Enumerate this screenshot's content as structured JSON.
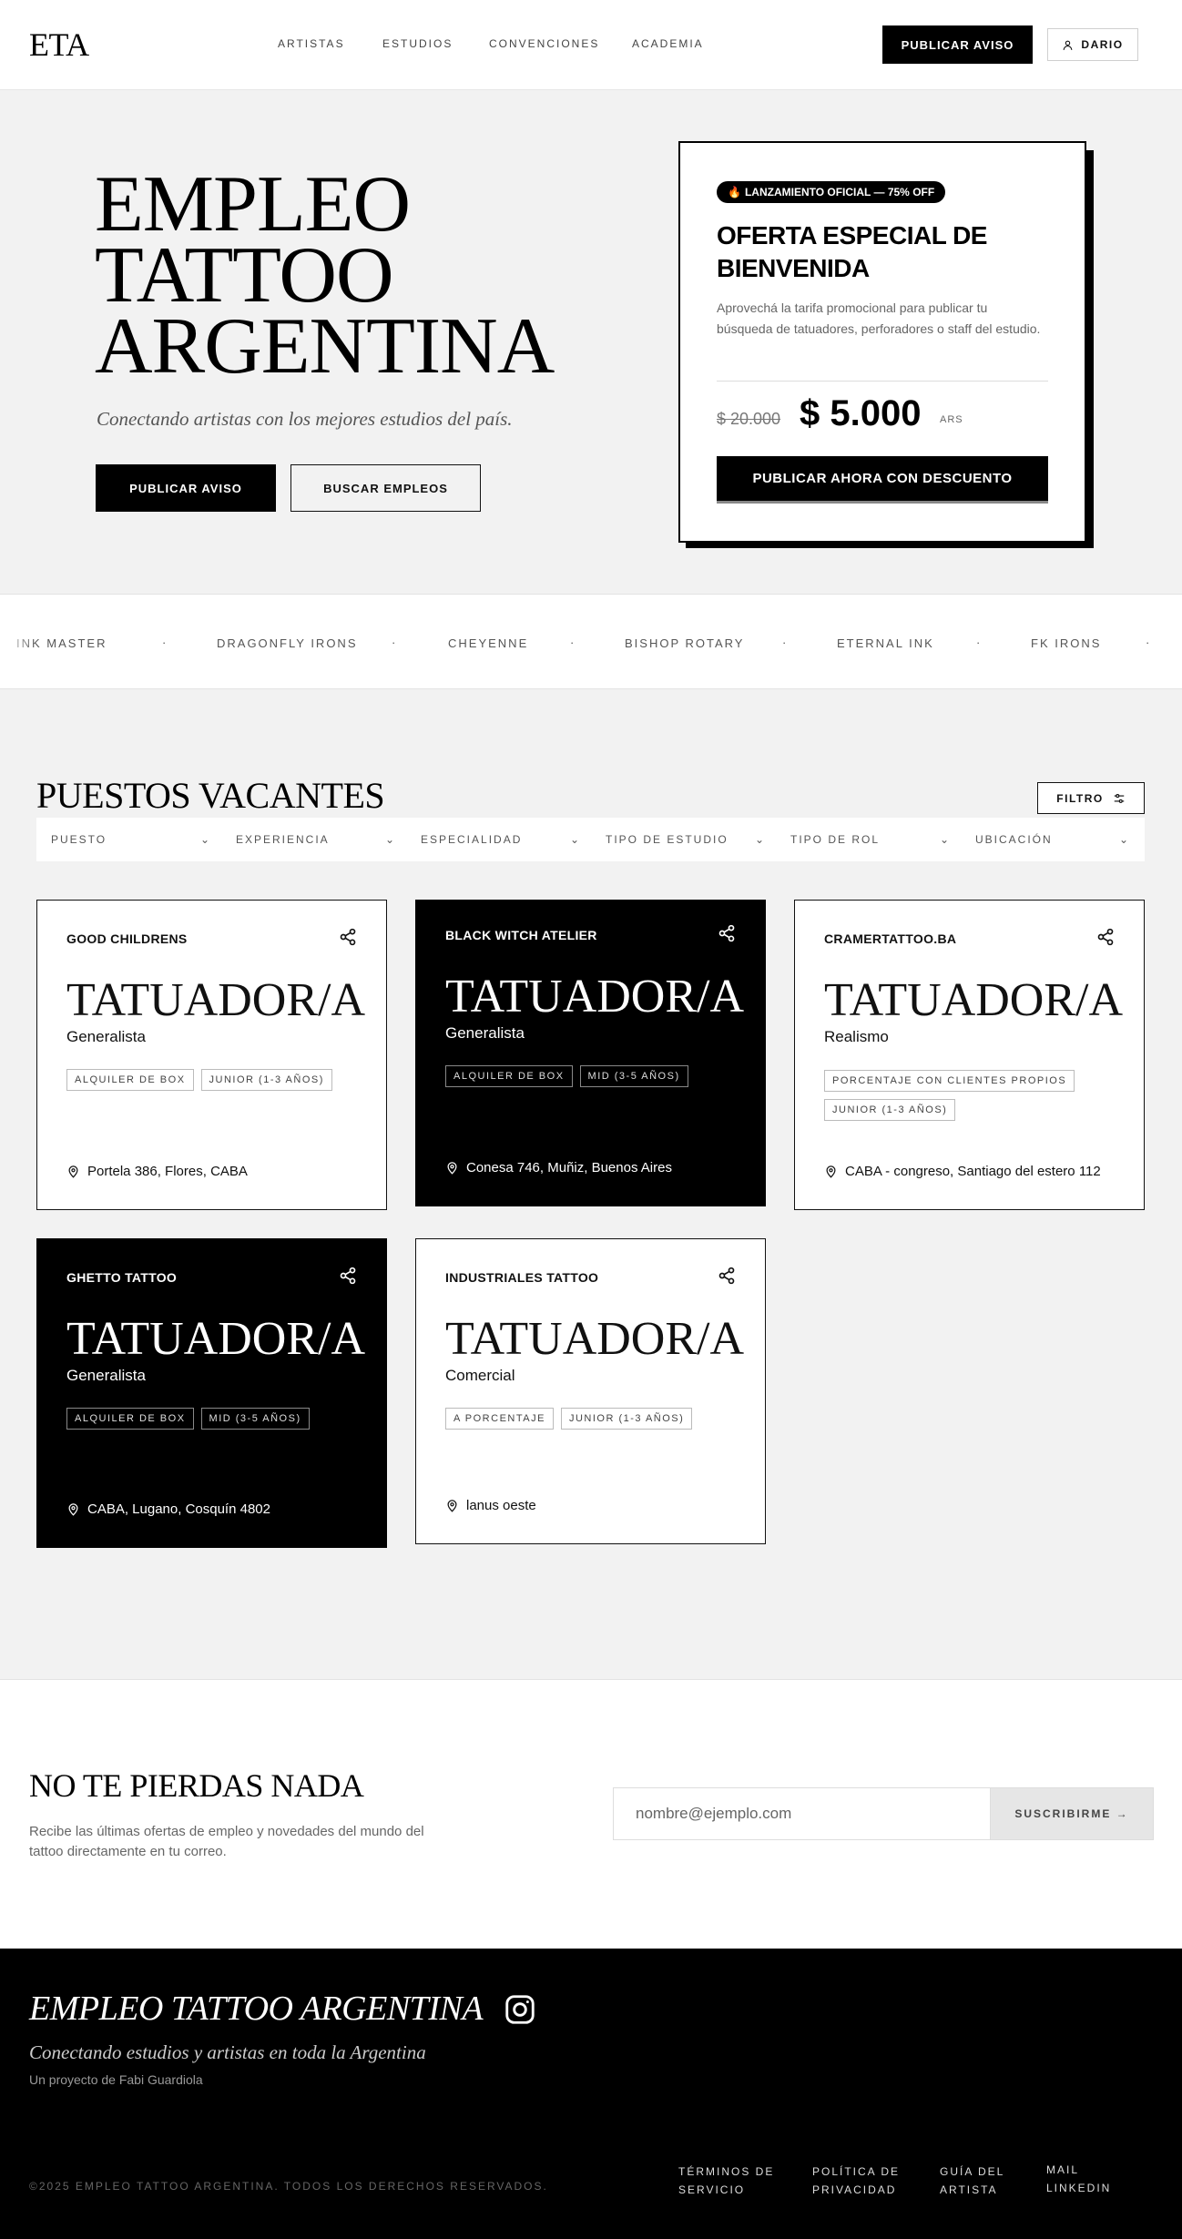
{
  "nav": {
    "logo": "ETA",
    "links": [
      "ARTISTAS",
      "ESTUDIOS",
      "CONVENCIONES",
      "ACADEMIA"
    ],
    "publish_label": "PUBLICAR AVISO",
    "user_label": "DARIO"
  },
  "hero": {
    "title_line1": "EMPLEO",
    "title_line2": "TATTOO",
    "title_line3": "ARGENTINA",
    "subtitle": "Conectando artistas con los mejores estudios del país.",
    "primary_label": "PUBLICAR AVISO",
    "secondary_label": "BUSCAR EMPLEOS"
  },
  "promo": {
    "badge": "LANZAMIENTO OFICIAL — 75% OFF",
    "title": "OFERTA ESPECIAL DE BIENVENIDA",
    "description": "Aprovechá la tarifa promocional para publicar tu búsqueda de tatuadores, perforadores o staff del estudio.",
    "old_price": "$ 20.000",
    "new_price": "$ 5.000",
    "currency": "ARS",
    "cta": "PUBLICAR AHORA CON DESCUENTO"
  },
  "brands": [
    "INK MASTER",
    "DRAGONFLY IRONS",
    "CHEYENNE",
    "BISHOP ROTARY",
    "ETERNAL INK",
    "FK IRONS"
  ],
  "vacancies": {
    "title": "PUESTOS VACANTES",
    "filter_label": "FILTRO",
    "filters": [
      "PUESTO",
      "EXPERIENCIA",
      "ESPECIALIDAD",
      "TIPO DE ESTUDIO",
      "TIPO DE ROL",
      "UBICACIÓN"
    ],
    "cards": [
      {
        "studio": "GOOD CHILDRENS",
        "role": "TATUADOR/A",
        "specialty": "Generalista",
        "tags": [
          "ALQUILER DE BOX",
          "JUNIOR (1-3 AÑOS)"
        ],
        "location": "Portela 386, Flores, CABA",
        "dark": false
      },
      {
        "studio": "BLACK WITCH ATELIER",
        "role": "TATUADOR/A",
        "specialty": "Generalista",
        "tags": [
          "ALQUILER DE BOX",
          "MID (3-5 AÑOS)"
        ],
        "location": "Conesa 746, Muñiz, Buenos Aires",
        "dark": true
      },
      {
        "studio": "CRAMERTATTOO.BA",
        "role": "TATUADOR/A",
        "specialty": "Realismo",
        "tags": [
          "PORCENTAJE CON CLIENTES PROPIOS",
          "JUNIOR (1-3 AÑOS)"
        ],
        "location": "CABA - congreso, Santiago del estero 112",
        "dark": false
      },
      {
        "studio": "GHETTO TATTOO",
        "role": "TATUADOR/A",
        "specialty": "Generalista",
        "tags": [
          "ALQUILER DE BOX",
          "MID (3-5 AÑOS)"
        ],
        "location": "CABA, Lugano, Cosquín 4802",
        "dark": true
      },
      {
        "studio": "INDUSTRIALES TATTOO",
        "role": "TATUADOR/A",
        "specialty": "Comercial",
        "tags": [
          "A PORCENTAJE",
          "JUNIOR (1-3 AÑOS)"
        ],
        "location": "lanus oeste",
        "dark": false
      }
    ]
  },
  "newsletter": {
    "title": "NO TE PIERDAS NADA",
    "description": "Recibe las últimas ofertas de empleo y novedades del mundo del tattoo directamente en tu correo.",
    "placeholder": "nombre@ejemplo.com",
    "button": "SUSCRIBIRME →"
  },
  "footer": {
    "title": "EMPLEO TATTOO ARGENTINA",
    "subtitle": "Conectando estudios y artistas en toda la Argentina",
    "byline": "Un proyecto de Fabi Guardiola",
    "copyright": "©2025 EMPLEO TATTOO ARGENTINA. TODOS LOS DERECHOS RESERVADOS.",
    "links": [
      "TÉRMINOS DE SERVICIO",
      "POLÍTICA DE PRIVACIDAD",
      "GUÍA DEL ARTISTA",
      "MAIL LINKEDIN"
    ]
  },
  "colors": {
    "accent": "#000000",
    "background": "#f2f2f2",
    "surface": "#ffffff"
  }
}
